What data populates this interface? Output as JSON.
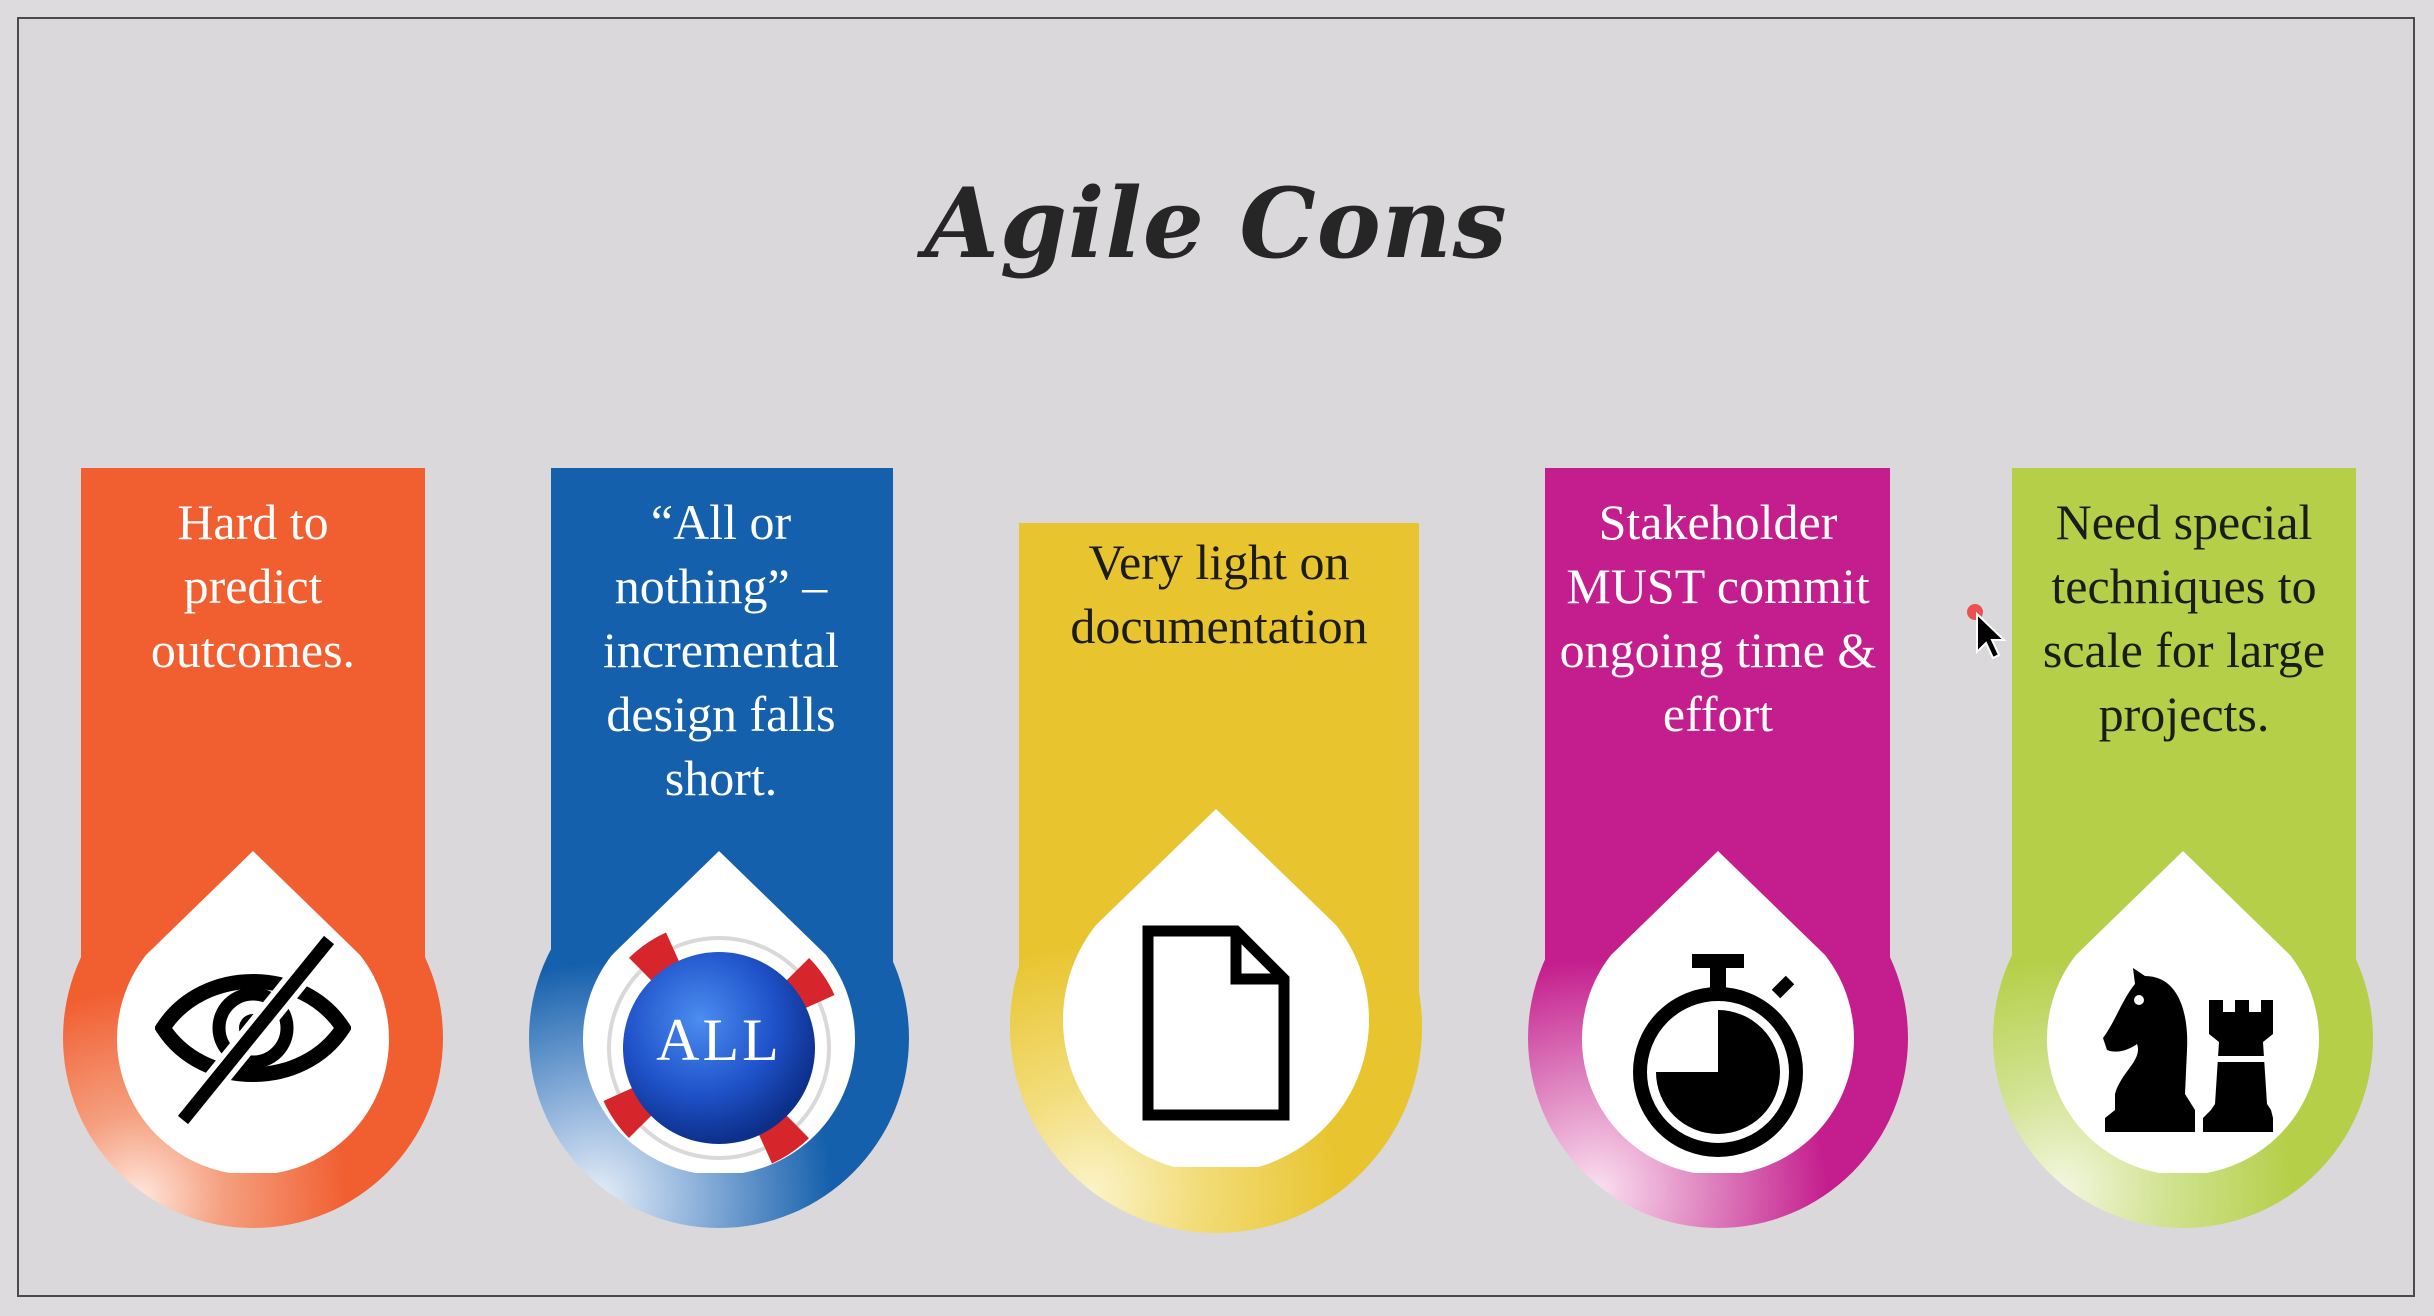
{
  "title": "Agile Cons",
  "cards": [
    {
      "label": "Hard to predict outcomes.",
      "color": "#f15e30",
      "icon": "eye-slash-icon"
    },
    {
      "label": "“All or nothing” – incremental design falls short.",
      "color": "#1560ac",
      "icon": "all-life-buoy-icon",
      "icon_text": "ALL"
    },
    {
      "label": "Very light on documentation",
      "color": "#e8c42e",
      "icon": "document-icon"
    },
    {
      "label": "Stakeholder MUST commit ongoing time & effort",
      "color": "#c41d8d",
      "icon": "stopwatch-icon"
    },
    {
      "label": "Need special techniques to scale for large projects.",
      "color": "#b5cf48",
      "icon": "chess-pieces-icon"
    }
  ]
}
